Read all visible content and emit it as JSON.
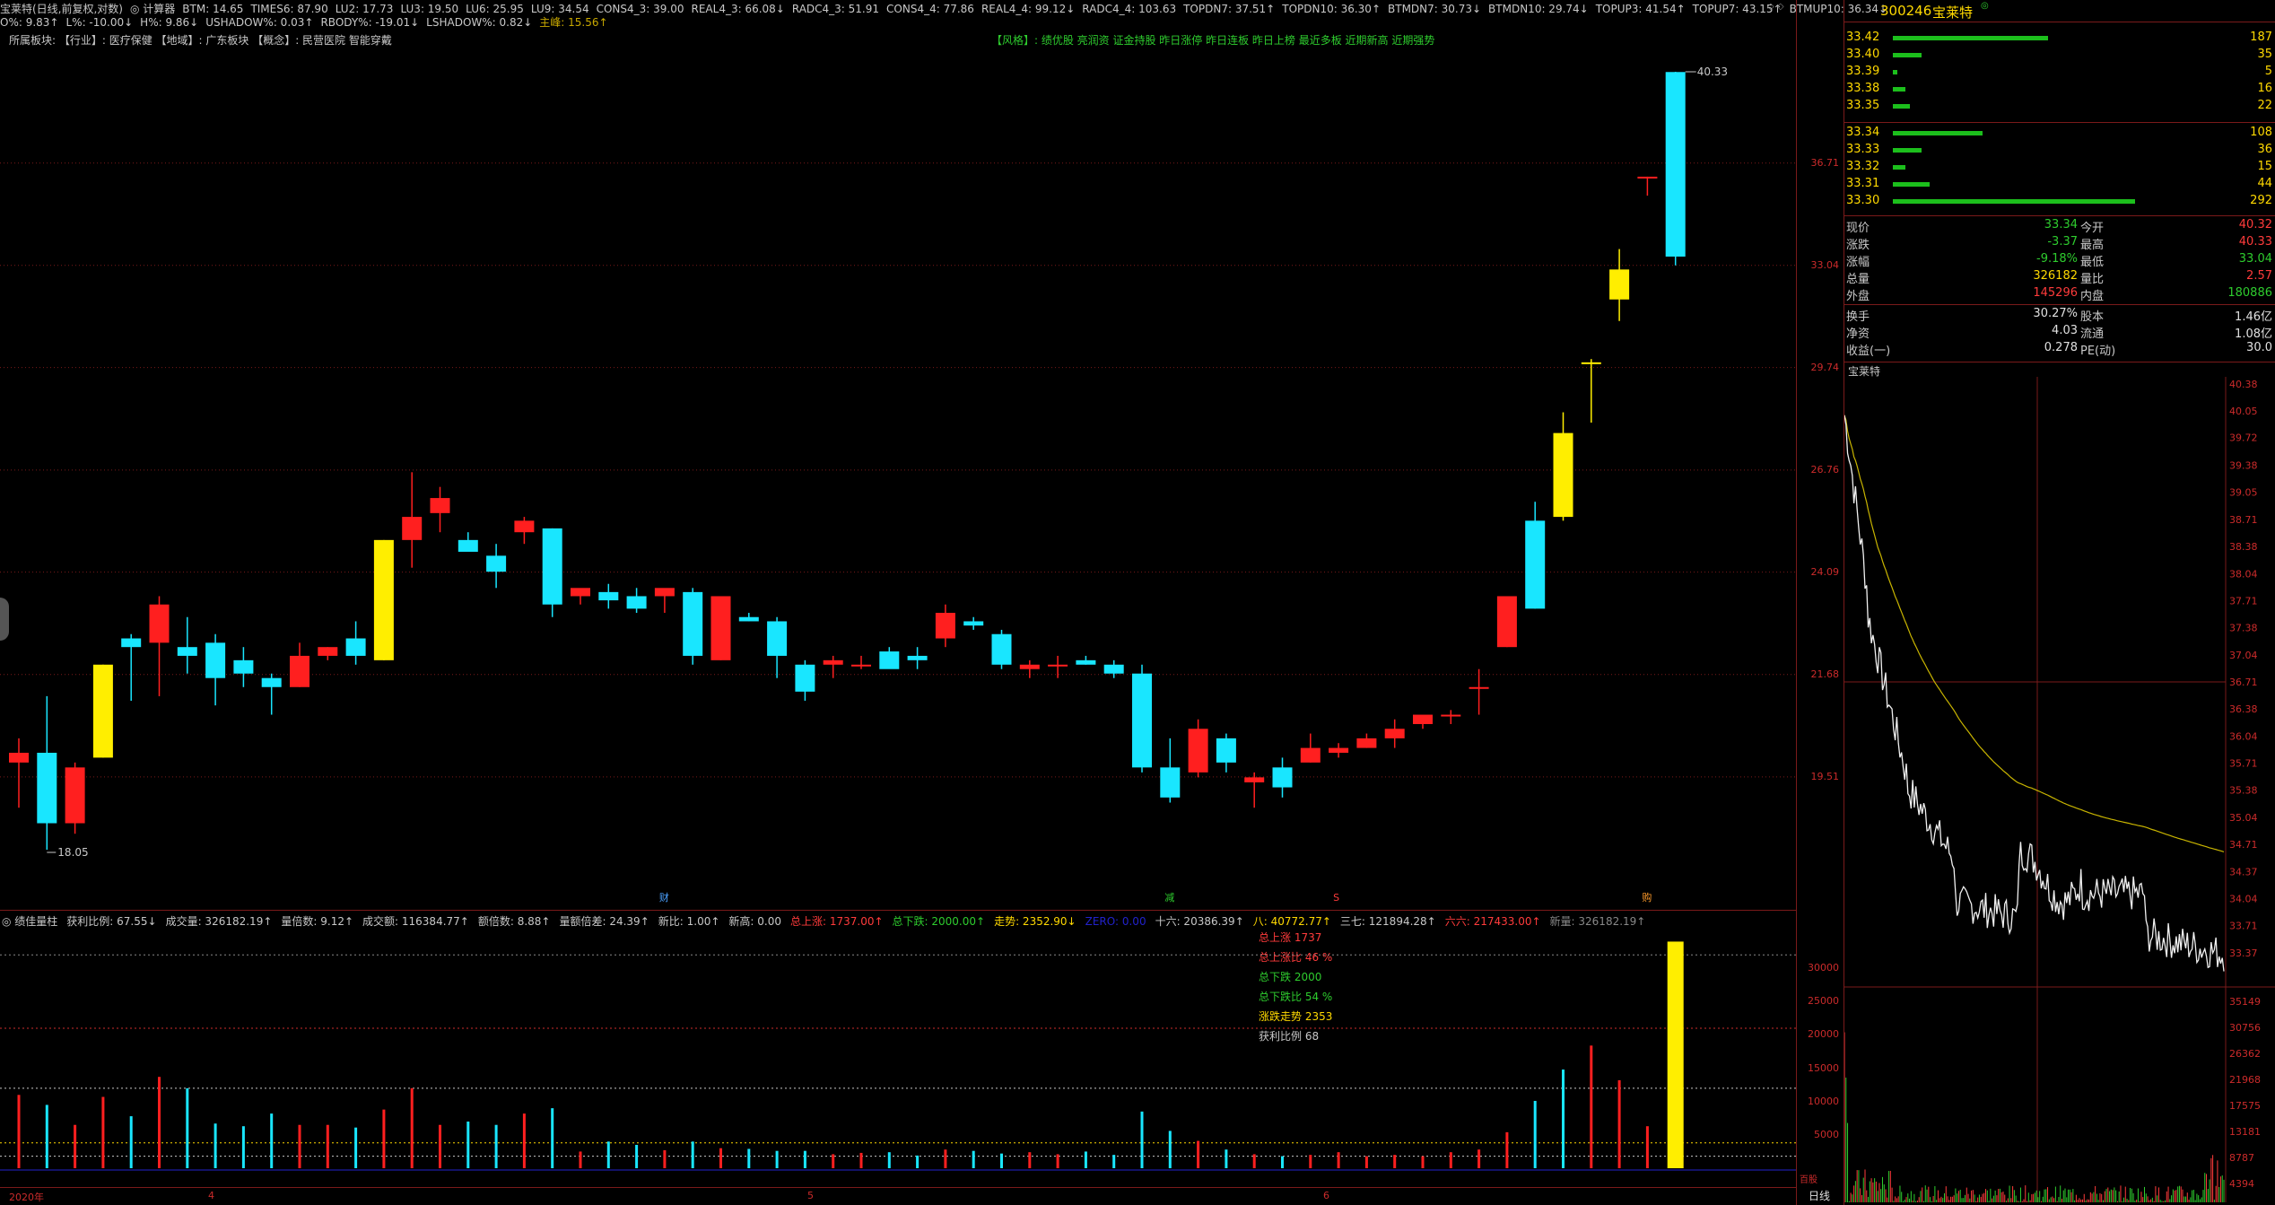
{
  "header": {
    "row1": [
      {
        "t": "宝莱特(日线,前复权,对数)",
        "c": "#c8c8c8"
      },
      {
        "t": "◎ 计算器",
        "c": "#c8c8c8"
      },
      {
        "t": "BTM: 14.65",
        "c": "#c8c8c8"
      },
      {
        "t": "TIMES6: 87.90",
        "c": "#c8c8c8"
      },
      {
        "t": "LU2: 17.73",
        "c": "#c8c8c8"
      },
      {
        "t": "LU3: 19.50",
        "c": "#c8c8c8"
      },
      {
        "t": "LU6: 25.95",
        "c": "#c8c8c8"
      },
      {
        "t": "LU9: 34.54",
        "c": "#c8c8c8"
      },
      {
        "t": "CONS4_3: 39.00",
        "c": "#c8c8c8"
      },
      {
        "t": "REAL4_3: 66.08↓",
        "c": "#c8c8c8"
      },
      {
        "t": "RADC4_3: 51.91",
        "c": "#c8c8c8"
      },
      {
        "t": "CONS4_4: 77.86",
        "c": "#c8c8c8"
      },
      {
        "t": "REAL4_4: 99.12↓",
        "c": "#c8c8c8"
      },
      {
        "t": "RADC4_4: 103.63",
        "c": "#c8c8c8"
      },
      {
        "t": "TOPDN7: 37.51↑",
        "c": "#c8c8c8"
      },
      {
        "t": "TOPDN10: 36.30↑",
        "c": "#c8c8c8"
      },
      {
        "t": "BTMDN7: 30.73↓",
        "c": "#c8c8c8"
      },
      {
        "t": "BTMDN10: 29.74↓",
        "c": "#c8c8c8"
      },
      {
        "t": "TOPUP3: 41.54↑",
        "c": "#c8c8c8"
      },
      {
        "t": "TOPUP7: 43.15↑",
        "c": "#c8c8c8"
      },
      {
        "t": "BTMUP10: 36.34↓",
        "c": "#c8c8c8"
      }
    ],
    "row2": [
      {
        "t": "O%: 9.83↑",
        "c": "#c8c8c8"
      },
      {
        "t": "L%: -10.00↓",
        "c": "#c8c8c8"
      },
      {
        "t": "H%: 9.86↓",
        "c": "#c8c8c8"
      },
      {
        "t": "USHADOW%: 0.03↑",
        "c": "#c8c8c8"
      },
      {
        "t": "RBODY%: -19.01↓",
        "c": "#c8c8c8"
      },
      {
        "t": "LSHADOW%: 0.82↓",
        "c": "#c8c8c8"
      },
      {
        "t": "主峰: 15.56↑",
        "c": "#c8a800"
      }
    ],
    "sector_line": "所属板块:  【行业】: 医疗保健  【地域】: 广东板块  【概念】: 民营医院 智能穿戴",
    "style_line": "【风格】: 绩优股 亮润资 证金持股 昨日涨停 昨日连板 昨日上榜 最近多板 近期新高 近期强势",
    "corner_icons": "◇ ◇"
  },
  "price_axis": [
    "36.71",
    "33.04",
    "29.74",
    "26.76",
    "24.09",
    "21.68",
    "19.51"
  ],
  "price_annotations": {
    "high": "40.33",
    "low": "18.05"
  },
  "markers": [
    {
      "t": "财",
      "c": "#4aa0ff"
    },
    {
      "t": "减",
      "c": "#2ecc2e"
    },
    {
      "t": "S",
      "c": "#ff3b3b"
    },
    {
      "t": "购",
      "c": "#ff9b2a"
    }
  ],
  "indicator": {
    "title": "◎ 绩佳量柱",
    "items": [
      {
        "t": "获利比例: 67.55↓",
        "c": "#c8c8c8"
      },
      {
        "t": "成交量: 326182.19↑",
        "c": "#c8c8c8"
      },
      {
        "t": "量倍数: 9.12↑",
        "c": "#c8c8c8"
      },
      {
        "t": "成交额: 116384.77↑",
        "c": "#c8c8c8"
      },
      {
        "t": "额倍数: 8.88↑",
        "c": "#c8c8c8"
      },
      {
        "t": "量额倍差: 24.39↑",
        "c": "#c8c8c8"
      },
      {
        "t": "新比: 1.00↑",
        "c": "#c8c8c8"
      },
      {
        "t": "新高: 0.00",
        "c": "#c8c8c8"
      },
      {
        "t": "总上涨: 1737.00↑",
        "c": "#ff3b3b"
      },
      {
        "t": "总下跌: 2000.00↑",
        "c": "#2ecc2e"
      },
      {
        "t": "走势: 2352.90↓",
        "c": "#ffd900"
      },
      {
        "t": "ZERO: 0.00",
        "c": "#2222cc"
      },
      {
        "t": "十六: 20386.39↑",
        "c": "#c8c8c8"
      },
      {
        "t": "八: 40772.77↑",
        "c": "#ffd900"
      },
      {
        "t": "三七: 121894.28↑",
        "c": "#c8c8c8"
      },
      {
        "t": "六六: 217433.00↑",
        "c": "#ff3b3b"
      },
      {
        "t": "新量: 326182.19↑",
        "c": "#888888"
      }
    ],
    "stats": [
      {
        "t": "总上涨 1737",
        "c": "#ff3b3b"
      },
      {
        "t": "总上涨比 46 %",
        "c": "#ff3b3b"
      },
      {
        "t": "总下跌 2000",
        "c": "#2ecc2e"
      },
      {
        "t": "总下跌比 54 %",
        "c": "#2ecc2e"
      },
      {
        "t": "涨跌走势 2353",
        "c": "#ffd900"
      },
      {
        "t": "获利比例 68",
        "c": "#c8c8c8"
      }
    ],
    "axis": [
      "30000",
      "25000",
      "20000",
      "15000",
      "10000",
      "5000"
    ],
    "unit": "百股"
  },
  "xaxis": {
    "labels": [
      "2020年",
      "4",
      "5",
      "6"
    ],
    "tab": "日线"
  },
  "right": {
    "code": "300246",
    "name": "宝莱特",
    "sell": [
      {
        "p": "33.42",
        "v": "187",
        "w": 0.64
      },
      {
        "p": "33.40",
        "v": "35",
        "w": 0.12
      },
      {
        "p": "33.39",
        "v": "5",
        "w": 0.02
      },
      {
        "p": "33.38",
        "v": "16",
        "w": 0.05
      },
      {
        "p": "33.35",
        "v": "22",
        "w": 0.07
      }
    ],
    "buy": [
      {
        "p": "33.34",
        "v": "108",
        "w": 0.37
      },
      {
        "p": "33.33",
        "v": "36",
        "w": 0.12
      },
      {
        "p": "33.32",
        "v": "15",
        "w": 0.05
      },
      {
        "p": "33.31",
        "v": "44",
        "w": 0.15
      },
      {
        "p": "33.30",
        "v": "292",
        "w": 1.0
      }
    ],
    "quote": [
      {
        "l": "现价",
        "m": "33.34",
        "mc": "#2ecc2e",
        "l2": "今开",
        "r": "40.32",
        "rc": "#ff3b3b"
      },
      {
        "l": "涨跌",
        "m": "-3.37",
        "mc": "#2ecc2e",
        "l2": "最高",
        "r": "40.33",
        "rc": "#ff3b3b"
      },
      {
        "l": "涨幅",
        "m": "-9.18%",
        "mc": "#2ecc2e",
        "l2": "最低",
        "r": "33.04",
        "rc": "#2ecc2e"
      },
      {
        "l": "总量",
        "m": "326182",
        "mc": "#ffd900",
        "l2": "量比",
        "r": "2.57",
        "rc": "#ff3b3b"
      },
      {
        "l": "外盘",
        "m": "145296",
        "mc": "#ff3b3b",
        "l2": "内盘",
        "r": "180886",
        "rc": "#2ecc2e"
      },
      {
        "l": "换手",
        "m": "30.27%",
        "mc": "#e0e0e0",
        "l2": "股本",
        "r": "1.46亿",
        "rc": "#e0e0e0"
      },
      {
        "l": "净资",
        "m": "4.03",
        "mc": "#e0e0e0",
        "l2": "流通",
        "r": "1.08亿",
        "rc": "#e0e0e0"
      },
      {
        "l": "收益(一)",
        "m": "0.278",
        "mc": "#e0e0e0",
        "l2": "PE(动)",
        "r": "30.0",
        "rc": "#e0e0e0"
      }
    ],
    "intraday_title": "宝莱特",
    "intraday_axis": [
      "40.38",
      "40.05",
      "39.72",
      "39.38",
      "39.05",
      "38.71",
      "38.38",
      "38.04",
      "37.71",
      "37.38",
      "37.04",
      "36.71",
      "36.38",
      "36.04",
      "35.71",
      "35.38",
      "35.04",
      "34.71",
      "34.37",
      "34.04",
      "33.71",
      "33.37"
    ],
    "intraday_vol_axis": [
      "35149",
      "30756",
      "26362",
      "21968",
      "17575",
      "13181",
      "8787",
      "4394"
    ]
  },
  "colors": {
    "up": "#ff1f1f",
    "down": "#19e6ff",
    "limit": "#ffee00",
    "grid": "#7a1a1a",
    "text": "#c8c8c8"
  },
  "chart_data": {
    "type": "candlestick",
    "candles": [
      [
        19.8,
        20.3,
        18.9,
        20.0
      ],
      [
        20.0,
        21.2,
        18.1,
        18.6
      ],
      [
        18.6,
        19.8,
        18.4,
        19.7
      ],
      [
        19.9,
        21.9,
        19.9,
        21.9
      ],
      [
        22.5,
        22.6,
        21.1,
        22.3
      ],
      [
        22.4,
        23.5,
        21.2,
        23.3
      ],
      [
        22.3,
        23.0,
        21.7,
        22.1
      ],
      [
        22.4,
        22.6,
        21.0,
        21.6
      ],
      [
        22.0,
        22.3,
        21.4,
        21.7
      ],
      [
        21.6,
        21.7,
        20.8,
        21.4
      ],
      [
        21.4,
        22.4,
        21.4,
        22.1
      ],
      [
        22.1,
        22.3,
        22.0,
        22.3
      ],
      [
        22.5,
        22.9,
        21.9,
        22.1
      ],
      [
        22.0,
        24.9,
        22.0,
        24.9
      ],
      [
        24.9,
        26.7,
        24.2,
        25.5
      ],
      [
        25.6,
        26.3,
        25.1,
        26.0
      ],
      [
        24.9,
        25.1,
        24.8,
        24.6
      ],
      [
        24.5,
        24.8,
        23.7,
        24.1
      ],
      [
        25.1,
        25.5,
        24.8,
        25.4
      ],
      [
        25.2,
        25.2,
        23.0,
        23.3
      ],
      [
        23.5,
        23.6,
        23.3,
        23.7
      ],
      [
        23.6,
        23.8,
        23.2,
        23.4
      ],
      [
        23.5,
        23.7,
        23.1,
        23.2
      ],
      [
        23.5,
        23.6,
        23.1,
        23.7
      ],
      [
        23.6,
        23.7,
        21.9,
        22.1
      ],
      [
        22.0,
        22.9,
        22.0,
        23.5
      ],
      [
        23.0,
        23.1,
        22.9,
        22.9
      ],
      [
        22.9,
        23.0,
        21.6,
        22.1
      ],
      [
        21.9,
        22.0,
        21.1,
        21.3
      ],
      [
        21.9,
        22.1,
        21.6,
        22.0
      ],
      [
        21.9,
        22.1,
        21.8,
        21.9
      ],
      [
        22.2,
        22.3,
        22.1,
        21.8
      ],
      [
        22.1,
        22.3,
        21.8,
        22.0
      ],
      [
        22.5,
        23.3,
        22.3,
        23.1
      ],
      [
        22.9,
        23.0,
        22.7,
        22.8
      ],
      [
        22.6,
        22.7,
        21.8,
        21.9
      ],
      [
        21.8,
        22.0,
        21.6,
        21.9
      ],
      [
        21.9,
        22.1,
        21.6,
        21.9
      ],
      [
        22.0,
        22.1,
        21.9,
        21.9
      ],
      [
        21.9,
        22.0,
        21.6,
        21.7
      ],
      [
        21.7,
        21.9,
        19.6,
        19.7
      ],
      [
        19.7,
        20.3,
        19.0,
        19.1
      ],
      [
        19.6,
        20.7,
        19.5,
        20.5
      ],
      [
        20.3,
        20.4,
        19.6,
        19.8
      ],
      [
        19.4,
        19.6,
        18.9,
        19.5
      ],
      [
        19.7,
        19.9,
        19.1,
        19.3
      ],
      [
        19.8,
        20.4,
        19.8,
        20.1
      ],
      [
        20.0,
        20.2,
        19.9,
        20.1
      ],
      [
        20.1,
        20.4,
        20.1,
        20.3
      ],
      [
        20.3,
        20.7,
        20.1,
        20.5
      ],
      [
        20.6,
        20.7,
        20.5,
        20.8
      ],
      [
        20.8,
        20.9,
        20.6,
        20.8
      ],
      [
        21.4,
        21.8,
        20.8,
        21.4
      ],
      [
        22.3,
        23.0,
        22.3,
        23.5
      ],
      [
        25.4,
        25.9,
        23.2,
        23.2
      ],
      [
        27.8,
        28.4,
        25.4,
        25.5
      ],
      [
        29.9,
        30.0,
        28.1,
        29.9
      ],
      [
        31.9,
        33.6,
        31.2,
        32.9
      ],
      [
        36.2,
        36.2,
        35.5,
        36.2
      ],
      [
        40.32,
        40.33,
        33.04,
        33.34
      ]
    ],
    "volumes": [
      11000,
      9500,
      6500,
      10700,
      7800,
      13700,
      12000,
      6700,
      6300,
      8200,
      6500,
      6500,
      6100,
      8800,
      12000,
      6500,
      7000,
      6500,
      8200,
      9000,
      2500,
      4000,
      3500,
      2700,
      4000,
      3000,
      2900,
      2600,
      2600,
      2100,
      2300,
      2400,
      1900,
      2800,
      2600,
      2200,
      2400,
      2100,
      2500,
      2000,
      8500,
      5600,
      4100,
      2800,
      2100,
      1800,
      2000,
      2400,
      1800,
      2000,
      1800,
      2400,
      2800,
      5400,
      10100,
      14800,
      18400,
      13200,
      6300,
      34000
    ],
    "volume_axis_max": 35000,
    "price_range": [
      18.05,
      40.33
    ],
    "intraday_range": [
      33.04,
      40.38
    ]
  }
}
